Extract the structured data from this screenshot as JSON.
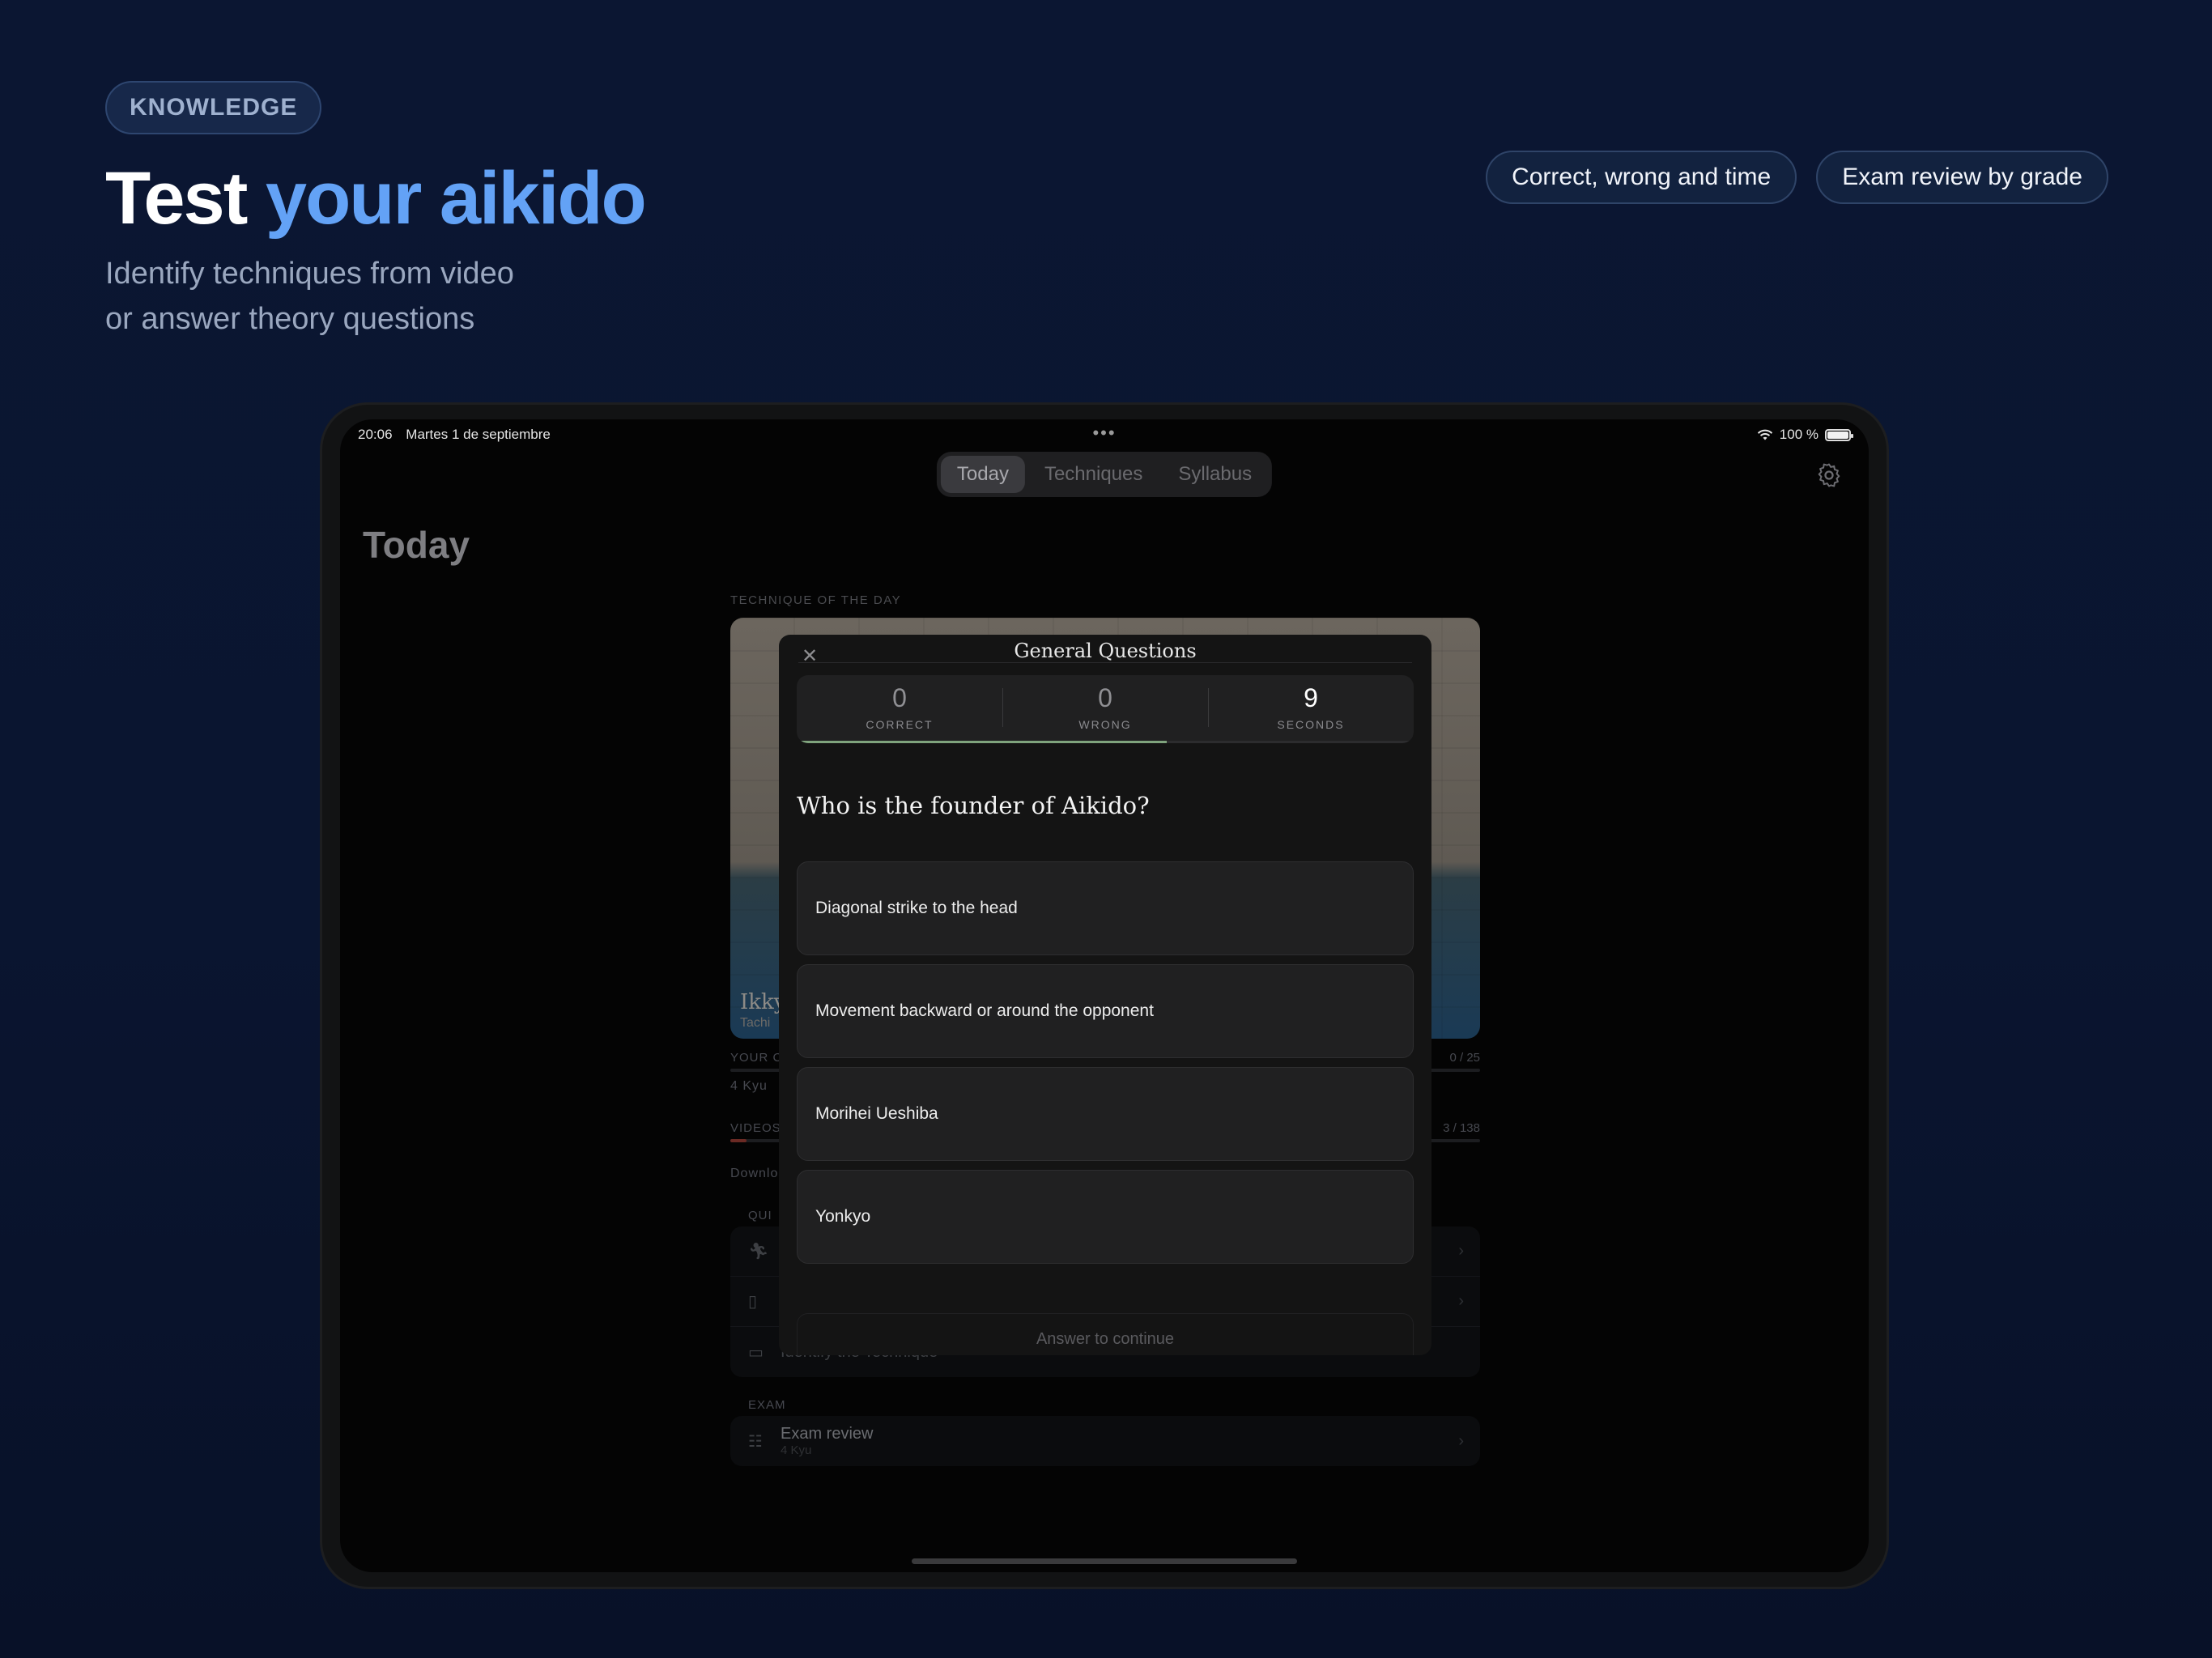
{
  "header": {
    "badge": "KNOWLEDGE",
    "title_plain": "Test ",
    "title_accent": "your aikido",
    "subtitle_line1": "Identify techniques from video",
    "subtitle_line2": "or answer theory questions",
    "pills": [
      "Correct, wrong and time",
      "Exam review by grade"
    ]
  },
  "colors": {
    "accent": "#63a2f6",
    "background": "#0b1632",
    "progress": "#7fa37d"
  },
  "status_bar": {
    "time": "20:06",
    "date": "Martes 1 de septiembre",
    "battery": "100 %"
  },
  "nav": {
    "tabs": [
      "Today",
      "Techniques",
      "Syllabus"
    ],
    "active_tab": "Today"
  },
  "page": {
    "title": "Today",
    "technique_of_day_label": "TECHNIQUE OF THE DAY",
    "technique_title": "Ikky",
    "technique_sub": "Tachi",
    "your_label": "YOUR C",
    "your_value": "0 / 25",
    "grade": "4 Kyu",
    "videos_label": "VIDEOS",
    "videos_value": "3 / 138",
    "videos_progress": 0.022,
    "download_label": "Downlo",
    "quiz_label": "QUI",
    "identify_technique": "Identify the Technique",
    "exam_label": "EXAM",
    "exam_review": "Exam review",
    "exam_review_sub": "4 Kyu"
  },
  "modal": {
    "title": "General Questions",
    "stats": {
      "correct": "0",
      "correct_label": "CORRECT",
      "wrong": "0",
      "wrong_label": "WRONG",
      "seconds": "9",
      "seconds_label": "SECONDS"
    },
    "timer_progress": 0.6,
    "question": "Who is the founder of Aikido?",
    "answers": [
      "Diagonal strike to the head",
      "Movement backward or around the opponent",
      "Morihei Ueshiba",
      "Yonkyo"
    ],
    "continue_label": "Answer to continue"
  }
}
